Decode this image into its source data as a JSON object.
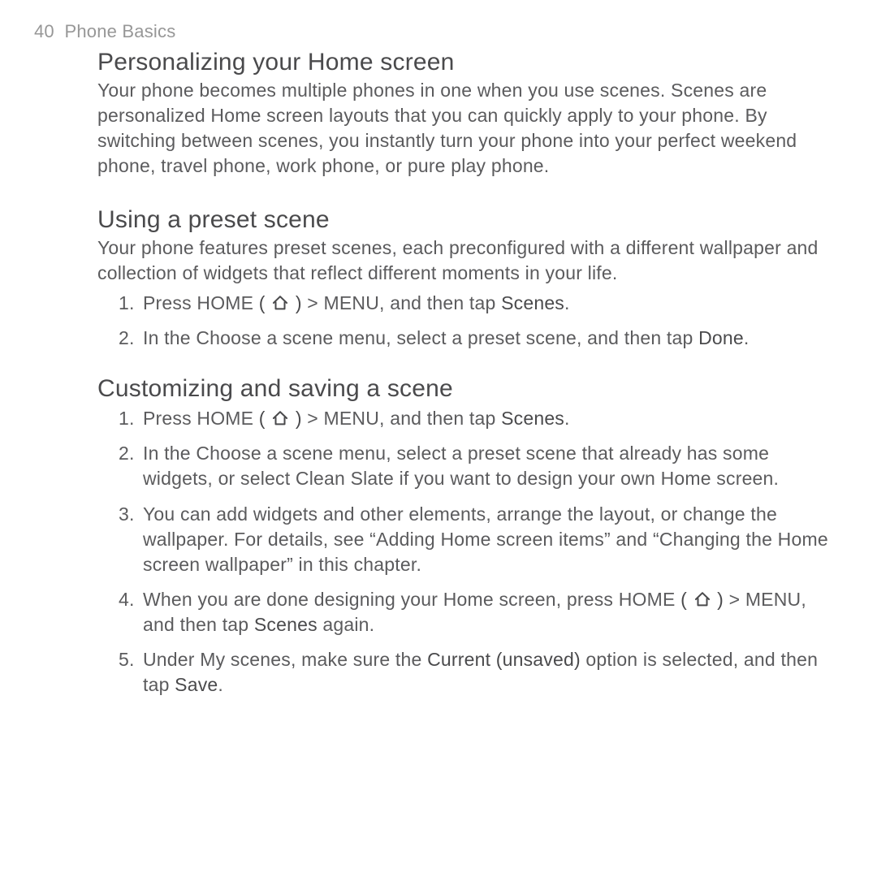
{
  "header": {
    "page": "40",
    "chapter": "Phone Basics"
  },
  "s1": {
    "title": "Personalizing your Home screen",
    "body": "Your phone becomes multiple phones in one when you use scenes. Scenes are personalized Home screen layouts that you can quickly apply to your phone. By switching between scenes, you instantly turn your phone into your perfect weekend phone, travel phone, work phone, or pure play phone."
  },
  "s2": {
    "title": "Using a preset scene",
    "body": "Your phone features preset scenes, each preconfigured with a different wallpaper and collection of widgets that reflect different moments in your life.",
    "li1_a": "Press HOME ",
    "li1_b": " > MENU, and then tap ",
    "li1_c": "Scenes",
    "li1_d": ".",
    "li2_a": "In the Choose a scene menu, select a preset scene, and then tap ",
    "li2_b": "Done",
    "li2_c": "."
  },
  "s3": {
    "title": "Customizing and saving a scene",
    "li1_a": "Press HOME ",
    "li1_b": " > MENU, and then tap ",
    "li1_c": "Scenes",
    "li1_d": ".",
    "li2": "In the Choose a scene menu, select a preset scene that already has some widgets, or select Clean Slate if you want to design your own Home screen.",
    "li3": "You can add widgets and other elements, arrange the layout, or change the wallpaper. For details, see “Adding Home screen items” and “Changing the Home screen wallpaper” in this chapter.",
    "li4_a": "When you are done designing your Home screen, press HOME ",
    "li4_b": " > MENU, and then tap ",
    "li4_c": "Scenes",
    "li4_d": " again.",
    "li5_a": "Under My scenes, make sure the ",
    "li5_b": "Current (unsaved)",
    "li5_c": " option is selected, and then tap ",
    "li5_d": "Save",
    "li5_e": "."
  },
  "glyphs": {
    "paren_open": "( ",
    "paren_close": " )"
  }
}
